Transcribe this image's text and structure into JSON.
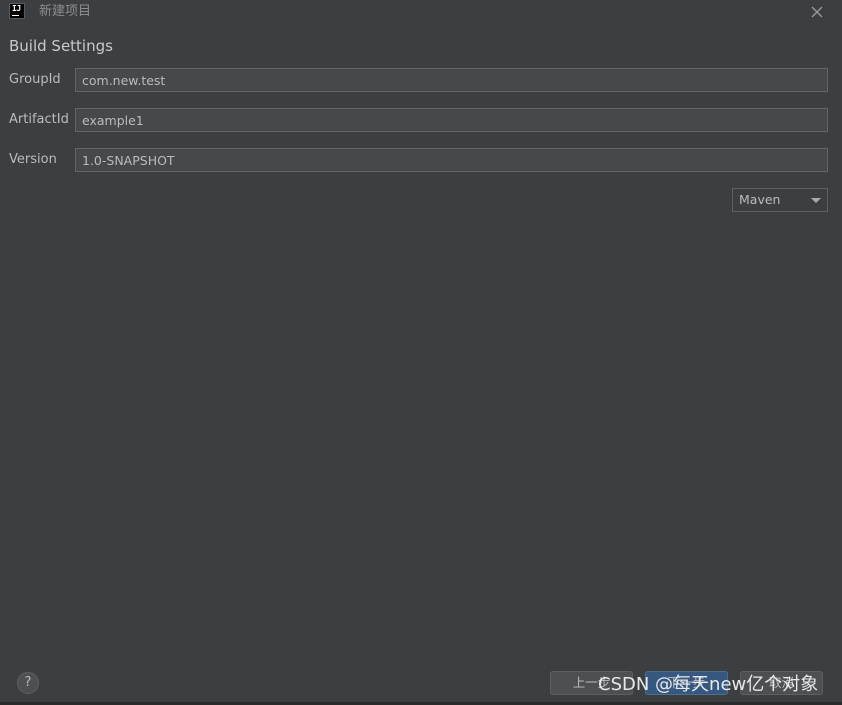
{
  "window": {
    "title": "新建项目",
    "app_icon_text": "IJ"
  },
  "section": {
    "title": "Build Settings"
  },
  "fields": [
    {
      "label": "GroupId",
      "value": "com.new.test"
    },
    {
      "label": "ArtifactId",
      "value": "example1"
    },
    {
      "label": "Version",
      "value": "1.0-SNAPSHOT"
    }
  ],
  "build_tool": {
    "selected": "Maven"
  },
  "footer": {
    "help_label": "?",
    "prev_label": "上一步",
    "next_label": "下一步",
    "cancel_label": "取消"
  },
  "watermark": "CSDN @每天new亿个对象",
  "colors": {
    "background": "#3c3f41",
    "input_bg": "#45494a",
    "primary_button": "#365880"
  }
}
